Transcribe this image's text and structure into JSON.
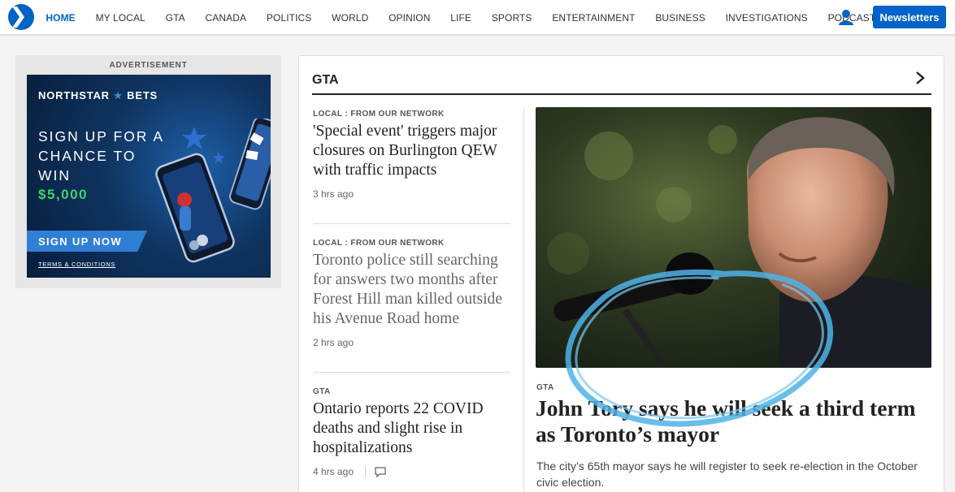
{
  "nav": {
    "logo_icon": "star-logo-icon",
    "items": [
      "HOME",
      "MY LOCAL",
      "GTA",
      "CANADA",
      "POLITICS",
      "WORLD",
      "OPINION",
      "LIFE",
      "SPORTS",
      "ENTERTAINMENT",
      "BUSINESS",
      "INVESTIGATIONS",
      "PODCASTS"
    ],
    "active_item": "HOME",
    "user_icon": "user-icon",
    "newsletters_label": "Newsletters",
    "accent_color": "#0063c7"
  },
  "ad": {
    "label": "ADVERTISEMENT",
    "brand": "NORTHSTAR",
    "brand_star": "★",
    "brand_suffix": "BETS",
    "headline": "SIGN UP FOR A CHANCE TO WIN",
    "amount": "$5,000",
    "cta": "SIGN UP NOW",
    "terms": "TERMS & CONDITIONS"
  },
  "section": {
    "title": "GTA",
    "arrow_icon": "chevron-right-icon"
  },
  "stories": [
    {
      "kicker": "LOCAL : FROM OUR NETWORK",
      "headline": "'Special event' triggers major closures on Burlington QEW with traffic impacts",
      "time": "3 hrs ago"
    },
    {
      "kicker": "LOCAL : FROM OUR NETWORK",
      "headline": "Toronto police still searching for answers two months after Forest Hill man killed outside his Avenue Road home",
      "time": "2 hrs ago"
    },
    {
      "kicker": "GTA",
      "headline": "Ontario reports 22 COVID deaths and slight rise in hospitalizations",
      "time": "4 hrs ago",
      "comment_icon": "comment-icon"
    }
  ],
  "lead": {
    "kicker": "GTA",
    "headline": "John Tory says he will seek a third term as Toronto’s mayor",
    "summary": "The city’s 65th mayor says he will register to seek re-election in the October civic election."
  }
}
